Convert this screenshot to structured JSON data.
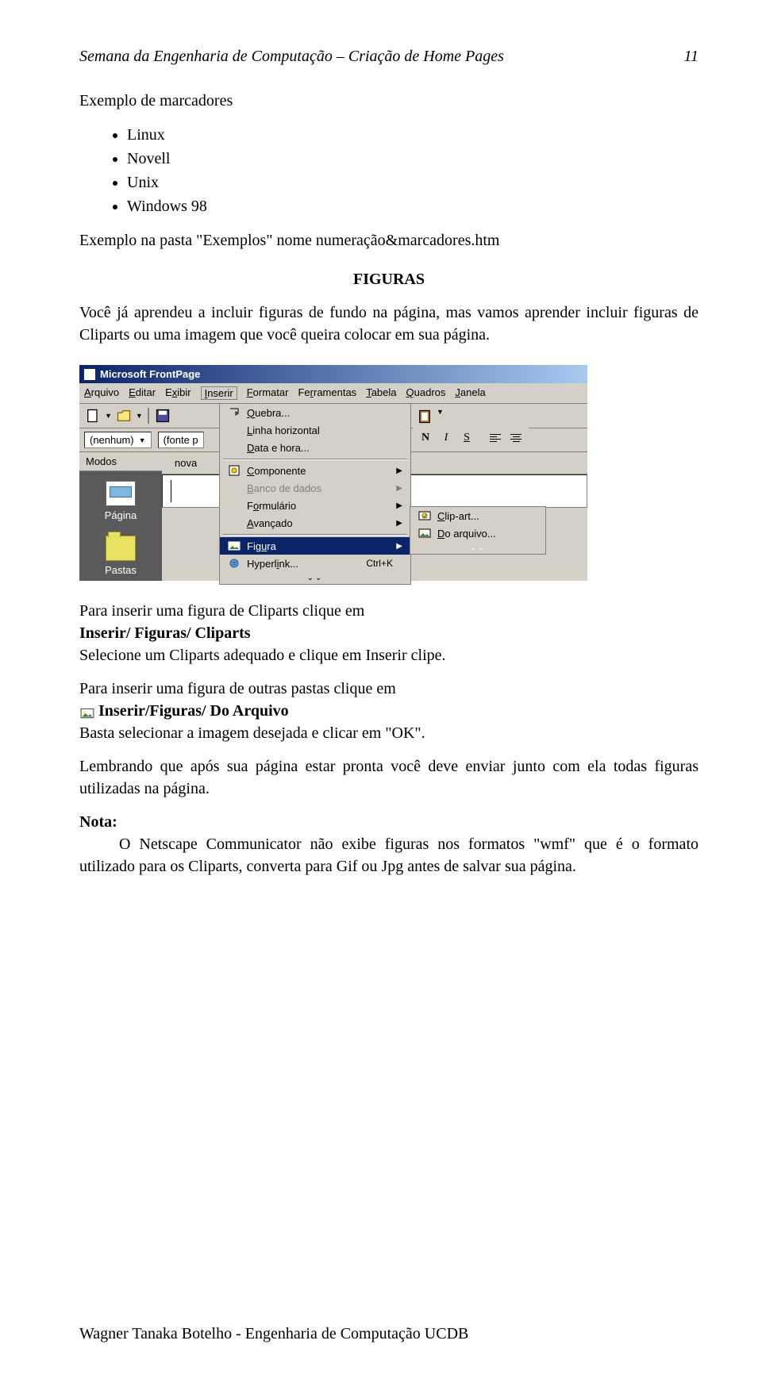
{
  "header": {
    "title_left": "Semana da Engenharia de Computação – Criação de Home Pages",
    "page_no": "11"
  },
  "text": {
    "exemplo_marc": "Exemplo de marcadores",
    "bullets": [
      "Linux",
      "Novell",
      "Unix",
      "Windows 98"
    ],
    "exemplo_pasta": "Exemplo na pasta \"Exemplos\" nome numeração&marcadores.htm",
    "section_title": "FIGURAS",
    "intro": "Você já aprendeu a incluir figuras de fundo na página, mas vamos aprender incluir figuras de Cliparts ou uma imagem que você queira colocar em sua página.",
    "para_cliparts_l1": "Para inserir uma figura de Cliparts clique em",
    "para_cliparts_l2": "Inserir/ Figuras/ Cliparts",
    "para_cliparts_l3": "Selecione um Cliparts adequado e clique em Inserir clipe.",
    "para_outras_l1": "Para inserir uma figura de outras pastas clique em",
    "para_outras_l2": "Inserir/Figuras/ Do Arquivo",
    "para_outras_l3": "Basta selecionar a imagem desejada e clicar em \"OK\".",
    "lembrando": "Lembrando que após sua página estar pronta você deve enviar junto com ela todas figuras utilizadas na página.",
    "nota_label": "Nota:",
    "nota_body": "O Netscape Communicator não exibe figuras nos formatos \"wmf\" que é o formato utilizado para os Cliparts, converta para Gif ou Jpg antes de salvar sua página."
  },
  "screenshot": {
    "app_title": "Microsoft FrontPage",
    "menubar": [
      "Arquivo",
      "Editar",
      "Exibir",
      "Inserir",
      "Formatar",
      "Ferramentas",
      "Tabela",
      "Quadros",
      "Janela"
    ],
    "style_combo": "(nenhum)",
    "font_combo": "(fonte p",
    "fmt_buttons": {
      "bold": "N",
      "italic": "I",
      "underline": "S"
    },
    "sidebar_header": "Modos",
    "sidebar_items": [
      "Página",
      "Pastas"
    ],
    "tab_label": "nova",
    "inserir_menu": {
      "items": [
        {
          "label": "Quebra...",
          "icon": "break-icon"
        },
        {
          "label": "Linha horizontal"
        },
        {
          "label": "Data e hora..."
        }
      ],
      "items2": [
        {
          "label": "Componente",
          "icon": "component-icon",
          "submenu": true
        },
        {
          "label": "Banco de dados",
          "disabled": true,
          "submenu": true
        },
        {
          "label": "Formulário",
          "submenu": true
        },
        {
          "label": "Avançado",
          "submenu": true
        }
      ],
      "items3": [
        {
          "label": "Figura",
          "icon": "image-icon",
          "highlight": true,
          "submenu": true
        },
        {
          "label": "Hyperlink...",
          "icon": "link-icon",
          "shortcut": "Ctrl+K"
        }
      ]
    },
    "figura_submenu": [
      {
        "label": "Clip-art...",
        "icon": "clipart-icon"
      },
      {
        "label": "Do arquivo...",
        "icon": "file-image-icon"
      }
    ]
  },
  "footer": "Wagner Tanaka Botelho - Engenharia de Computação UCDB"
}
